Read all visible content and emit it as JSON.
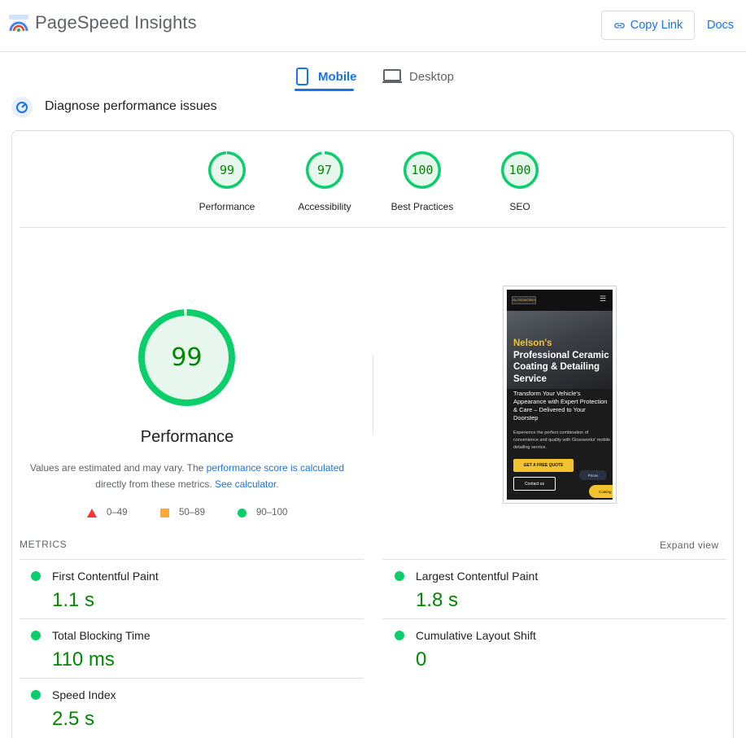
{
  "header": {
    "app_title": "PageSpeed Insights",
    "copy_link_label": "Copy Link",
    "docs_label": "Docs"
  },
  "tabs": [
    {
      "label": "Mobile",
      "active": true,
      "icon": "smartphone-icon"
    },
    {
      "label": "Desktop",
      "active": false,
      "icon": "laptop-icon"
    }
  ],
  "section_title": "Diagnose performance issues",
  "scores": [
    {
      "label": "Performance",
      "value": "99",
      "fraction": 0.99
    },
    {
      "label": "Accessibility",
      "value": "97",
      "fraction": 0.97
    },
    {
      "label": "Best Practices",
      "value": "100",
      "fraction": 1.0
    },
    {
      "label": "SEO",
      "value": "100",
      "fraction": 1.0
    }
  ],
  "main_score": {
    "value": "99",
    "fraction": 0.99,
    "label": "Performance",
    "note_prefix": "Values are estimated and may vary. The ",
    "note_link1": "performance score is calculated",
    "note_mid": "directly from these metrics. ",
    "note_link2": "See calculator",
    "note_suffix": "."
  },
  "legend": [
    {
      "range": "0–49",
      "shape": "triangle",
      "color": "#ff3333"
    },
    {
      "range": "50–89",
      "shape": "square",
      "color": "#ffaa33"
    },
    {
      "range": "90–100",
      "shape": "circle",
      "color": "#0cce6b"
    }
  ],
  "thumbnail": {
    "logo_text": "GLOSSWORKS",
    "heading_accent": "Nelson's",
    "heading": "Professional Ceramic Coating & Detailing Service",
    "subheading": "Transform Your Vehicle's Appearance with Expert Protection & Care – Delivered to Your Doorstep",
    "paragraph": "Experience the perfect combination of convenience and quality with Glossworks' mobile detailing service.",
    "cta": "GET A FREE QUOTE",
    "contact": "Contact us",
    "pill1": "Prices",
    "pill2": "Coating Quiz"
  },
  "metrics": {
    "heading": "METRICS",
    "expand_label": "Expand view",
    "items": [
      {
        "title": "First Contentful Paint",
        "value": "1.1 s"
      },
      {
        "title": "Largest Contentful Paint",
        "value": "1.8 s"
      },
      {
        "title": "Total Blocking Time",
        "value": "110 ms"
      },
      {
        "title": "Cumulative Layout Shift",
        "value": "0"
      },
      {
        "title": "Speed Index",
        "value": "2.5 s"
      }
    ]
  },
  "colors": {
    "accent": "#1a73e8",
    "pass": "#0cce6b",
    "pass_text": "#008800",
    "pass_fill": "#e8f7ee"
  }
}
